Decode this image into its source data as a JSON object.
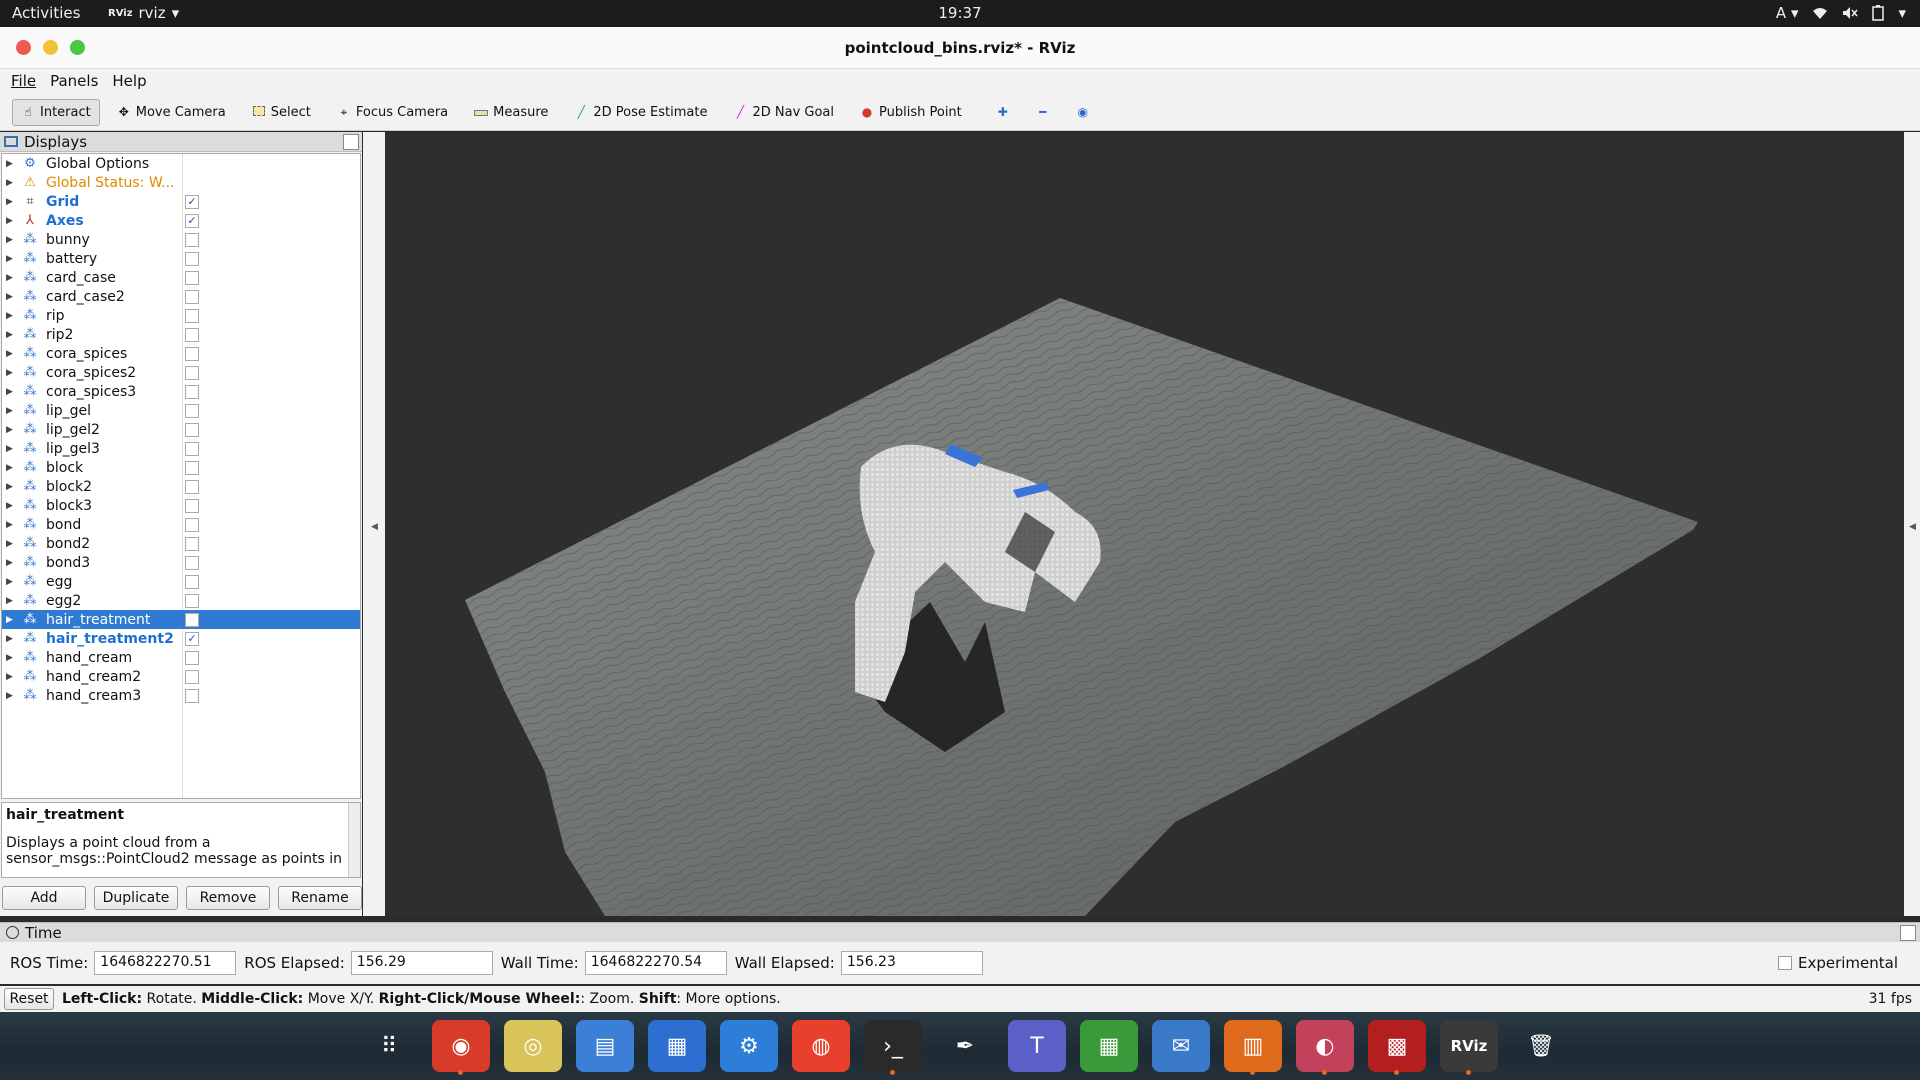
{
  "topbar": {
    "activities": "Activities",
    "app_name": "rviz",
    "app_badge": "RViz",
    "clock": "19:37",
    "input_method": "A",
    "menu_caret": "▾"
  },
  "window": {
    "title": "pointcloud_bins.rviz* - RViz"
  },
  "menu": {
    "file": "File",
    "panels": "Panels",
    "help": "Help"
  },
  "toolbar": {
    "interact": "Interact",
    "move_camera": "Move Camera",
    "select": "Select",
    "focus_camera": "Focus Camera",
    "measure": "Measure",
    "pose_estimate": "2D Pose Estimate",
    "nav_goal": "2D Nav Goal",
    "publish_point": "Publish Point"
  },
  "displays": {
    "header": "Displays",
    "items": [
      {
        "label": "Global Options",
        "icon": "gear-icon",
        "checked": null,
        "style": "normal"
      },
      {
        "label": "Global Status: W...",
        "icon": "warning-icon",
        "checked": null,
        "style": "warn"
      },
      {
        "label": "Grid",
        "icon": "grid-icon",
        "checked": true,
        "style": "bold"
      },
      {
        "label": "Axes",
        "icon": "axes-icon",
        "checked": true,
        "style": "bold"
      },
      {
        "label": "bunny",
        "icon": "pointcloud-icon",
        "checked": false,
        "style": "normal"
      },
      {
        "label": "battery",
        "icon": "pointcloud-icon",
        "checked": false,
        "style": "normal"
      },
      {
        "label": "card_case",
        "icon": "pointcloud-icon",
        "checked": false,
        "style": "normal"
      },
      {
        "label": "card_case2",
        "icon": "pointcloud-icon",
        "checked": false,
        "style": "normal"
      },
      {
        "label": "rip",
        "icon": "pointcloud-icon",
        "checked": false,
        "style": "normal"
      },
      {
        "label": "rip2",
        "icon": "pointcloud-icon",
        "checked": false,
        "style": "normal"
      },
      {
        "label": "cora_spices",
        "icon": "pointcloud-icon",
        "checked": false,
        "style": "normal"
      },
      {
        "label": "cora_spices2",
        "icon": "pointcloud-icon",
        "checked": false,
        "style": "normal"
      },
      {
        "label": "cora_spices3",
        "icon": "pointcloud-icon",
        "checked": false,
        "style": "normal"
      },
      {
        "label": "lip_gel",
        "icon": "pointcloud-icon",
        "checked": false,
        "style": "normal"
      },
      {
        "label": "lip_gel2",
        "icon": "pointcloud-icon",
        "checked": false,
        "style": "normal"
      },
      {
        "label": "lip_gel3",
        "icon": "pointcloud-icon",
        "checked": false,
        "style": "normal"
      },
      {
        "label": "block",
        "icon": "pointcloud-icon",
        "checked": false,
        "style": "normal"
      },
      {
        "label": "block2",
        "icon": "pointcloud-icon",
        "checked": false,
        "style": "normal"
      },
      {
        "label": "block3",
        "icon": "pointcloud-icon",
        "checked": false,
        "style": "normal"
      },
      {
        "label": "bond",
        "icon": "pointcloud-icon",
        "checked": false,
        "style": "normal"
      },
      {
        "label": "bond2",
        "icon": "pointcloud-icon",
        "checked": false,
        "style": "normal"
      },
      {
        "label": "bond3",
        "icon": "pointcloud-icon",
        "checked": false,
        "style": "normal"
      },
      {
        "label": "egg",
        "icon": "pointcloud-icon",
        "checked": false,
        "style": "normal"
      },
      {
        "label": "egg2",
        "icon": "pointcloud-icon",
        "checked": false,
        "style": "normal"
      },
      {
        "label": "hair_treatment",
        "icon": "pointcloud-icon",
        "checked": false,
        "style": "selected"
      },
      {
        "label": "hair_treatment2",
        "icon": "pointcloud-icon",
        "checked": true,
        "style": "bold"
      },
      {
        "label": "hand_cream",
        "icon": "pointcloud-icon",
        "checked": false,
        "style": "normal"
      },
      {
        "label": "hand_cream2",
        "icon": "pointcloud-icon",
        "checked": false,
        "style": "normal"
      },
      {
        "label": "hand_cream3",
        "icon": "pointcloud-icon",
        "checked": false,
        "style": "normal"
      }
    ],
    "description_title": "hair_treatment",
    "description_text": "Displays a point cloud from a sensor_msgs::PointCloud2 message as points in",
    "buttons": {
      "add": "Add",
      "duplicate": "Duplicate",
      "remove": "Remove",
      "rename": "Rename"
    }
  },
  "time": {
    "header": "Time",
    "ros_time_label": "ROS Time:",
    "ros_time": "1646822270.51",
    "ros_elapsed_label": "ROS Elapsed:",
    "ros_elapsed": "156.29",
    "wall_time_label": "Wall Time:",
    "wall_time": "1646822270.54",
    "wall_elapsed_label": "Wall Elapsed:",
    "wall_elapsed": "156.23",
    "experimental": "Experimental"
  },
  "status": {
    "reset": "Reset",
    "hint_left_key": "Left-Click:",
    "hint_left": " Rotate. ",
    "hint_mid_key": "Middle-Click:",
    "hint_mid": " Move X/Y. ",
    "hint_right_key": "Right-Click/Mouse Wheel:",
    "hint_right": ": Zoom. ",
    "hint_shift_key": "Shift",
    "hint_shift": ": More options.",
    "fps": "31 fps"
  },
  "dock": [
    {
      "name": "apps-grid-icon",
      "glyph": "⠿",
      "color": "transparent",
      "running": false
    },
    {
      "name": "chrome-icon",
      "glyph": "◉",
      "color": "#d93b2b",
      "running": true
    },
    {
      "name": "rhythmbox-icon",
      "glyph": "◎",
      "color": "#d9c45a",
      "running": false
    },
    {
      "name": "files-icon",
      "glyph": "▤",
      "color": "#3b7fd6",
      "running": false
    },
    {
      "name": "writer-icon",
      "glyph": "▦",
      "color": "#2c6fd1",
      "running": false
    },
    {
      "name": "settings-icon",
      "glyph": "⚙",
      "color": "#2c7ed8",
      "running": false
    },
    {
      "name": "help-icon",
      "glyph": "◍",
      "color": "#e8402c",
      "running": false
    },
    {
      "name": "terminal-icon",
      "glyph": "›_",
      "color": "#2a2a2a",
      "running": true
    },
    {
      "name": "inkscape-icon",
      "glyph": "✒",
      "color": "transparent",
      "running": false
    },
    {
      "name": "teams-icon",
      "glyph": "T",
      "color": "#5b5fc7",
      "running": false
    },
    {
      "name": "calc-icon",
      "glyph": "▦",
      "color": "#3a9a3a",
      "running": false
    },
    {
      "name": "thunderbird-icon",
      "glyph": "✉",
      "color": "#3a78c8",
      "running": false
    },
    {
      "name": "impress-icon",
      "glyph": "▥",
      "color": "#e06a1c",
      "running": true
    },
    {
      "name": "image-viewer-icon",
      "glyph": "◐",
      "color": "#c2425c",
      "running": true
    },
    {
      "name": "gazebo-icon",
      "glyph": "▩",
      "color": "#b31f1f",
      "running": true
    },
    {
      "name": "rviz-icon",
      "glyph": "RViz",
      "color": "#3a3a3a",
      "running": true
    },
    {
      "name": "trash-icon",
      "glyph": "🗑",
      "color": "transparent",
      "running": false
    }
  ]
}
